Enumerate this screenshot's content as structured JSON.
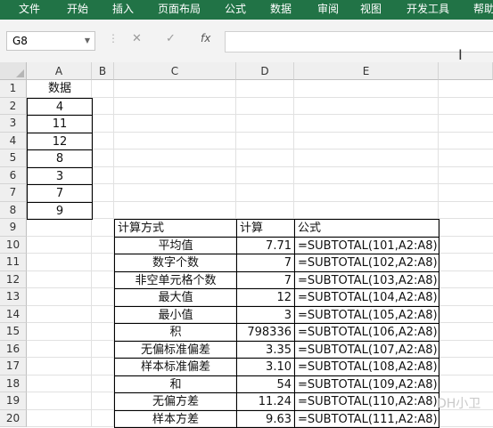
{
  "ribbon_tabs": [
    "文件",
    "开始",
    "插入",
    "页面布局",
    "公式",
    "数据",
    "审阅",
    "视图",
    "开发工具",
    "帮助"
  ],
  "formula_bar": {
    "name_box": "G8",
    "fx_label": "fx",
    "cancel_symbol": "✕",
    "enter_symbol": "✓",
    "formula": ""
  },
  "columns": [
    "A",
    "B",
    "C",
    "D",
    "E"
  ],
  "rows": [
    "1",
    "2",
    "3",
    "4",
    "5",
    "6",
    "7",
    "8",
    "9",
    "10",
    "11",
    "12",
    "13",
    "14",
    "15",
    "16",
    "17",
    "18",
    "19",
    "20"
  ],
  "data_column": {
    "header": "数据",
    "values": [
      "4",
      "11",
      "12",
      "8",
      "3",
      "7",
      "9"
    ]
  },
  "calc_table": {
    "headers": [
      "计算方式",
      "计算",
      "公式"
    ],
    "rows": [
      [
        "平均值",
        "7.71",
        "=SUBTOTAL(101,A2:A8)"
      ],
      [
        "数字个数",
        "7",
        "=SUBTOTAL(102,A2:A8)"
      ],
      [
        "非空单元格个数",
        "7",
        "=SUBTOTAL(103,A2:A8)"
      ],
      [
        "最大值",
        "12",
        "=SUBTOTAL(104,A2:A8)"
      ],
      [
        "最小值",
        "3",
        "=SUBTOTAL(105,A2:A8)"
      ],
      [
        "积",
        "798336",
        "=SUBTOTAL(106,A2:A8)"
      ],
      [
        "无偏标准偏差",
        "3.35",
        "=SUBTOTAL(107,A2:A8)"
      ],
      [
        "样本标准偏差",
        "3.10",
        "=SUBTOTAL(108,A2:A8)"
      ],
      [
        "和",
        "54",
        "=SUBTOTAL(109,A2:A8)"
      ],
      [
        "无偏方差",
        "11.24",
        "=SUBTOTAL(110,A2:A8)"
      ],
      [
        "样本方差",
        "9.63",
        "=SUBTOTAL(111,A2:A8)"
      ]
    ]
  },
  "watermark": "DH小卫",
  "colors": {
    "ribbon": "#217346",
    "header_bg": "#efefef",
    "gridline": "#e1e1e1"
  }
}
